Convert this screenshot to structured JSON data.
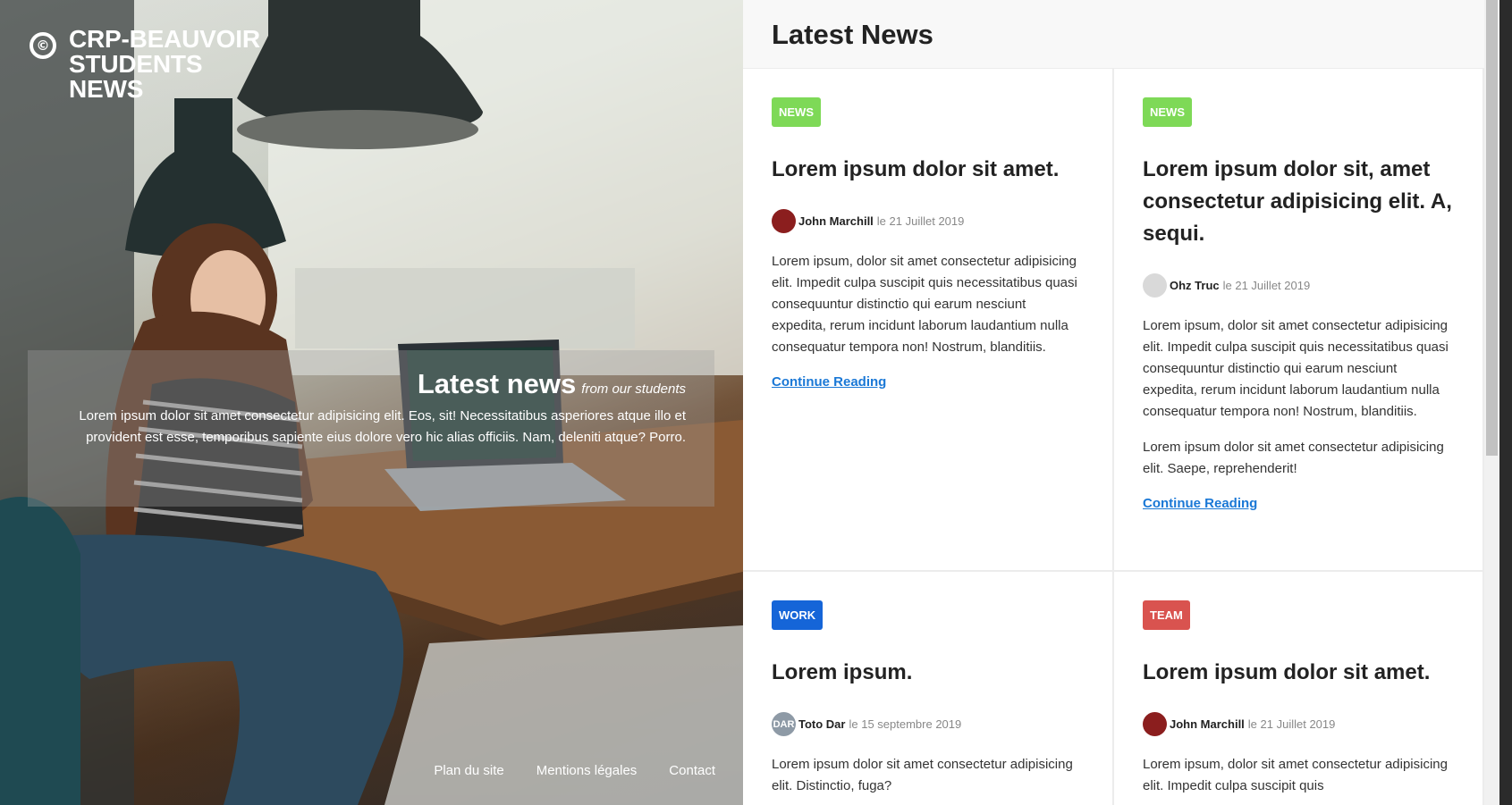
{
  "hero": {
    "brand_logo": "©",
    "brand_name": "CRP-Beauvoir Students News",
    "box_title": "Latest news",
    "box_subtitle": "from our students",
    "box_text": "Lorem ipsum dolor sit amet consectetur adipisicing elit. Eos, sit! Necessitatibus asperiores atque illo et provident est esse, temporibus sapiente eius dolore vero hic alias officiis. Nam, deleniti atque? Porro.",
    "footer_links": [
      "Plan du site",
      "Mentions légales",
      "Contact"
    ]
  },
  "content": {
    "title": "Latest News",
    "cards": [
      {
        "badge": "NEWS",
        "badge_color": "#7ed957",
        "title": "Lorem ipsum dolor sit amet.",
        "author": "John Marchill",
        "date": "le 21 Juillet 2019",
        "avatar_text": "",
        "avatar_color": "#8b1e1e",
        "paragraphs": [
          "Lorem ipsum, dolor sit amet consectetur adipisicing elit. Impedit culpa suscipit quis necessitatibus quasi consequuntur distinctio qui earum nesciunt expedita, rerum incidunt laborum laudantium nulla consequatur tempora non! Nostrum, blanditiis."
        ],
        "link": "Continue Reading"
      },
      {
        "badge": "NEWS",
        "badge_color": "#7ed957",
        "title": "Lorem ipsum dolor sit, amet consectetur adipisicing elit. A, sequi.",
        "author": "Ohz Truc",
        "date": "le 21 Juillet 2019",
        "avatar_text": "",
        "avatar_color": "#d9d9d9",
        "paragraphs": [
          "Lorem ipsum, dolor sit amet consectetur adipisicing elit. Impedit culpa suscipit quis necessitatibus quasi consequuntur distinctio qui earum nesciunt expedita, rerum incidunt laborum laudantium nulla consequatur tempora non! Nostrum, blanditiis.",
          "Lorem ipsum dolor sit amet consectetur adipisicing elit. Saepe, reprehenderit!"
        ],
        "link": "Continue Reading"
      },
      {
        "badge": "WORK",
        "badge_color": "#1565d8",
        "title": "Lorem ipsum.",
        "author": "Toto Dar",
        "date": "le 15 septembre 2019",
        "avatar_text": "DAR",
        "avatar_color": "#8e9aa6",
        "paragraphs": [
          "Lorem ipsum dolor sit amet consectetur adipisicing elit. Distinctio, fuga?"
        ],
        "link": ""
      },
      {
        "badge": "TEAM",
        "badge_color": "#d9534f",
        "title": "Lorem ipsum dolor sit amet.",
        "author": "John Marchill",
        "date": "le 21 Juillet 2019",
        "avatar_text": "",
        "avatar_color": "#8b1e1e",
        "paragraphs": [
          "Lorem ipsum, dolor sit amet consectetur adipisicing elit. Impedit culpa suscipit quis"
        ],
        "link": ""
      }
    ]
  }
}
